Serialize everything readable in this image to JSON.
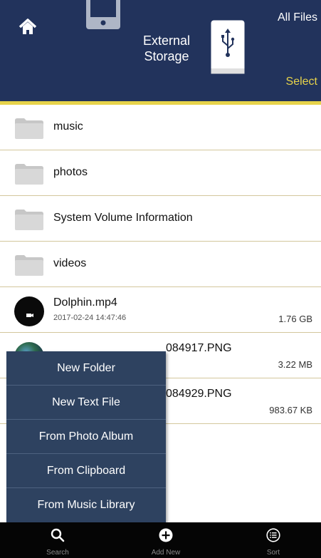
{
  "header": {
    "title": "External Storage",
    "all_files_label": "All Files",
    "select_label": "Select"
  },
  "files": [
    {
      "name": "music",
      "type": "folder"
    },
    {
      "name": "photos",
      "type": "folder"
    },
    {
      "name": "System Volume Information",
      "type": "folder"
    },
    {
      "name": "videos",
      "type": "folder"
    },
    {
      "name": "Dolphin.mp4",
      "type": "video",
      "date": "2017-02-24 14:47:46",
      "size": "1.76 GB"
    },
    {
      "name": "IMG_1104_00170301084917.PNG",
      "visible_name_fragment": "084917.PNG",
      "type": "image",
      "size": "3.22 MB"
    },
    {
      "name": "084929.PNG",
      "type": "image",
      "size": "983.67 KB"
    }
  ],
  "add_menu": {
    "items": [
      "New Folder",
      "New Text File",
      "From Photo Album",
      "From Clipboard",
      "From Music Library"
    ]
  },
  "tabbar": {
    "search_label": "Search",
    "add_new_label": "Add New",
    "sort_label": "Sort"
  },
  "colors": {
    "header_bg": "#22335c",
    "accent_yellow": "#e7d34a",
    "menu_bg": "#2e4260",
    "tabbar_bg": "#050505"
  }
}
